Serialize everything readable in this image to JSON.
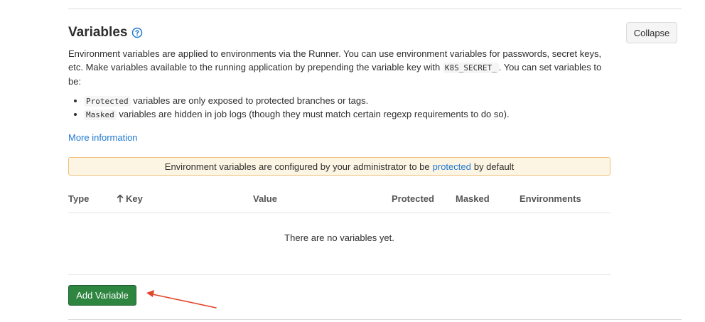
{
  "section": {
    "title": "Variables",
    "collapse_label": "Collapse",
    "description_part1": "Environment variables are applied to environments via the Runner. You can use environment variables for passwords, secret keys, etc. Make variables available to the running application by prepending the variable key with",
    "description_code": "K8S_SECRET_",
    "description_part2": ". You can set variables to be:",
    "bullets": [
      {
        "code": "Protected",
        "text": "variables are only exposed to protected branches or tags."
      },
      {
        "code": "Masked",
        "text": "variables are hidden in job logs (though they must match certain regexp requirements to do so)."
      }
    ],
    "more_info": "More information"
  },
  "alert": {
    "text_before": "Environment variables are configured by your administrator to be",
    "link": "protected",
    "text_after": "by default"
  },
  "table": {
    "headers": {
      "type": "Type",
      "key": "Key",
      "value": "Value",
      "protected": "Protected",
      "masked": "Masked",
      "environments": "Environments"
    },
    "sort_icon": "arrow-up-icon",
    "empty_text": "There are no variables yet."
  },
  "add_button": "Add Variable",
  "colors": {
    "accent": "#1f78d1",
    "primary_button": "#2e8540",
    "alert_bg": "#fdf5e4",
    "annotation_arrow": "#e24329"
  }
}
